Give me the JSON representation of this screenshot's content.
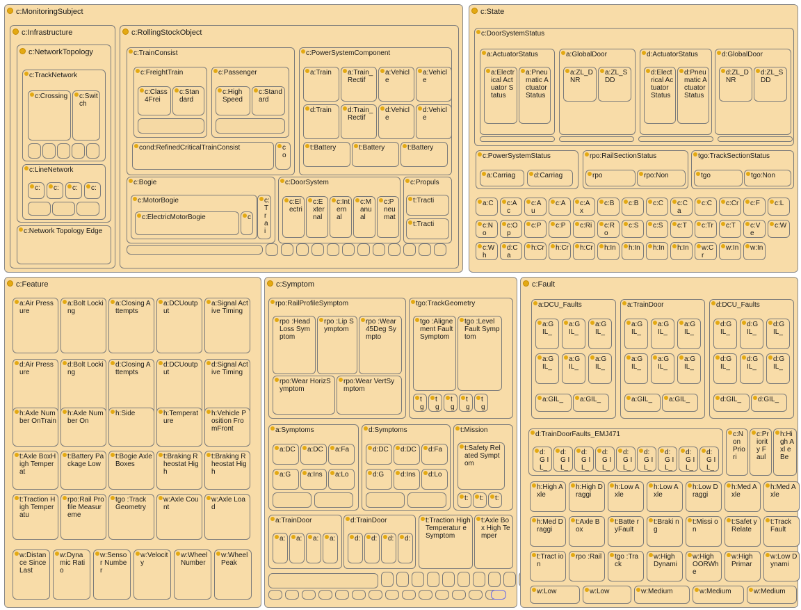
{
  "panels": {
    "monitoring_subject": "c:MonitoringSubject",
    "infrastructure": "c:Infrastructure",
    "network_topology": "c:NetworkTopology",
    "track_network": "c:TrackNetwork",
    "crossing": "c:Crossing",
    "switch": "c:Switch",
    "line_network": "c:LineNetwork",
    "line_network_items": [
      "c:",
      "c:",
      "c:",
      "c:"
    ],
    "network_topology_edge": "c:Network Topology Edge",
    "rolling_stock_object": "c:RollingStockObject",
    "train_consist": "c:TrainConsist",
    "freight_train": "c:FreightTrain",
    "freight_items": [
      "c:Class4Frei",
      "c:Standard"
    ],
    "passenger": "c:Passenger",
    "passenger_items": [
      "c:High Speed",
      "c:Standard"
    ],
    "refined_consist": "cond:RefinedCriticalTrainConsist",
    "co": "co",
    "power_system_component": "c:PowerSystemComponent",
    "power_items": [
      "a:Train",
      "a:Train_Rectif",
      "a:Vehicle",
      "a:Vehicle",
      "d:Train",
      "d:Train_Rectif",
      "d:Vehicle",
      "d:Vehicle",
      "t:Battery",
      "t:Battery",
      "t:Battery"
    ],
    "bogie": "c:Bogie",
    "motor_bogie": "c:MotorBogie",
    "electric_motor_bogie": "c:ElectricMotorBogie",
    "c_small": "c",
    "c_trai": "c:Trai",
    "door_system": "c:DoorSystem",
    "door_items": [
      "c:Electri",
      "c:External",
      "c:Internal",
      "c:Manual",
      "c:Pneumat"
    ],
    "propulsion": "c:Propuls",
    "propulsion_items": [
      "t:Tracti",
      "t:Tracti"
    ],
    "state": "c:State",
    "door_system_status": "c:DoorSystemStatus",
    "a_actuator_status": "a:ActuatorStatus",
    "a_actuator_items": [
      "a:Electrical Actuator Status",
      "a:Pneumatic Actuator Status"
    ],
    "a_global_door": "a:GlobalDoor",
    "a_global_items": [
      "a:ZL_DNR",
      "a:ZL_SDD"
    ],
    "d_actuator_status": "d:ActuatorStatus",
    "d_actuator_items": [
      "d:Electrical Actuator Status",
      "d:Pneumatic Actuator Status"
    ],
    "d_global_door": "d:GlobalDoor",
    "d_global_items": [
      "d:ZL_DNR",
      "d:ZL_SDD"
    ],
    "power_system_status": "c:PowerSystemStatus",
    "power_status_items": [
      "a:Carriag",
      "d:Carriag"
    ],
    "rail_section_status": "rpo:RailSectionStatus",
    "rail_status_items": [
      "rpo",
      "rpo:Non"
    ],
    "track_section_status": "tgo:TrackSectionStatus",
    "track_status_items": [
      "tgo",
      "tgo:Non"
    ],
    "state_grid": [
      "a:C",
      "c:Ac",
      "c:Au",
      "c:A",
      "c:Ax",
      "c:B",
      "c:B",
      "c:C",
      "c:Ca",
      "c:C",
      "c:Cr",
      "c:F",
      "c:L",
      "c:No",
      "c:Op",
      "c:P",
      "c:P",
      "c:Ri",
      "c:Ro",
      "c:S",
      "c:S",
      "c:T",
      "c:Tr",
      "c:T",
      "c:Ve",
      "c:W",
      "c:Wh",
      "d:Ca",
      "h:Cr",
      "h:Cr",
      "h:Cr",
      "h:In",
      "h:In",
      "h:In",
      "h:In",
      "w:Cr",
      "w:In",
      "w:In"
    ],
    "feature": "c:Feature",
    "feature_items": [
      "a:Air Pressure",
      "a:Bolt Locking",
      "a:Closing Attempts",
      "a:DCUoutput",
      "a:Signal Active Timing",
      "d:Air Pressure",
      "d:Bolt Locking",
      "d:Closing Attempts",
      "d:DCUoutput",
      "d:Signal Active Timing",
      "h:Axle Number OnTrain",
      "h:Axle Number On",
      "h:Side",
      "h:Temperature",
      "h:Vehicle Position FromFront",
      "t:Axle BoxHigh Temperat",
      "t:Battery Package Low",
      "t:Bogie Axle Boxes",
      "t:Braking Rheostat High",
      "t:Braking Rheostat High",
      "t:Traction High Temperatu",
      "rpo:Rail Profile Measureme",
      "tgo :Track Geometry",
      "w:Axle Count",
      "w:Axle Load",
      "w:Distance Since Last",
      "w:Dynamic Ratio",
      "w:Sensor Number",
      "w:Velocity",
      "w:Wheel Number",
      "w:Wheel Peak"
    ],
    "symptom": "c:Symptom",
    "rail_profile_symptom": "rpo:RailProfileSymptom",
    "rail_profile_items": [
      "rpo :Head Loss Symptom",
      "rpo :Lip Symptom",
      "rpo :Wear 45Deg Sympto",
      "rpo:Wear HorizSymptom",
      "rpo:Wear VertSymptom"
    ],
    "track_geometry": "tgo:TrackGeometry",
    "track_geometry_items": [
      "tgo :Alignement Fault Symptom",
      "tgo :Level Fault Symptom"
    ],
    "tg_items": [
      "tg",
      "tg",
      "tg",
      "tg",
      "tg"
    ],
    "a_symptoms": "a:Symptoms",
    "a_symptom_items": [
      "a:DC",
      "a:DC",
      "a:Fa",
      "a:G",
      "a:Ins",
      "a:Lo"
    ],
    "d_symptoms": "d:Symptoms",
    "d_symptom_items": [
      "d:DC",
      "d:DC",
      "d:Fa",
      "d:G",
      "d:Ins",
      "d:Lo"
    ],
    "mission": "t:Mission",
    "mission_item": "t:Safety Related Symptom",
    "mission_small": [
      "t:",
      "t:",
      "t:"
    ],
    "a_train_door": "a:TrainDoor",
    "a_train_door_items": [
      "a:",
      "a:",
      "a:",
      "a:"
    ],
    "d_train_door": "d:TrainDoor",
    "d_train_door_items": [
      "d:",
      "d:",
      "d:",
      "d:"
    ],
    "traction_symptom": "t:Traction High Temperatur eSymptom",
    "axle_box_symptom": "t:Axle Box High Temper",
    "fault": "c:Fault",
    "a_dcu_faults": "a:DCU_Faults",
    "a_dcu_items": [
      "a:G IL_",
      "a:G IL_",
      "a:G IL_",
      "a:G IL_",
      "a:G IL_",
      "a:G IL_",
      "a:GIL_",
      "a:GIL_"
    ],
    "a_train_door_f": "a:TrainDoor",
    "a_train_door_f_items": [
      "a:G IL_",
      "a:G IL_",
      "a:G IL_",
      "a:G IL_",
      "a:G IL_",
      "a:G IL_",
      "a:GIL_",
      "a:GIL_"
    ],
    "d_dcu_faults": "d:DCU_Faults",
    "d_dcu_items": [
      "d:G IL_",
      "d:G IL_",
      "d:G IL_",
      "d:G IL_",
      "d:G IL_",
      "d:G IL_",
      "d:GIL_",
      "d:GIL_"
    ],
    "d_train_door_faults": "d:TrainDoorFaults_EMJ471",
    "d_tdf_items": [
      "d:G IL_",
      "d:G IL_",
      "d:G IL_",
      "d:G IL_",
      "d:G IL_",
      "d:G IL_",
      "d:G IL_",
      "d:G IL_",
      "d:G IL_"
    ],
    "fault_side": [
      "c:Non Priori",
      "c:Priority Faul",
      "h:High Axl eBe"
    ],
    "fault_grid": [
      "h:High Axle",
      "h:High Draggi",
      "h:Low Axle",
      "h:Low Axle",
      "h:Low Draggi",
      "h:Med Axle",
      "h:Med Axle",
      "h:Med Draggi",
      "t:Axle Box",
      "t:Batte ryFault",
      "t:Braki ng",
      "t:Missi on",
      "t:Safet yRelate",
      "t:Track Fault",
      "t:Tract ion",
      "rpo :Rail",
      "tgo :Track",
      "w:High Dynami",
      "w:High OORWhe",
      "w:High Primar",
      "w:Low Dynami",
      "w:Low",
      "w:Low",
      "w:Medium",
      "w:Medium",
      "w:Medium"
    ]
  }
}
